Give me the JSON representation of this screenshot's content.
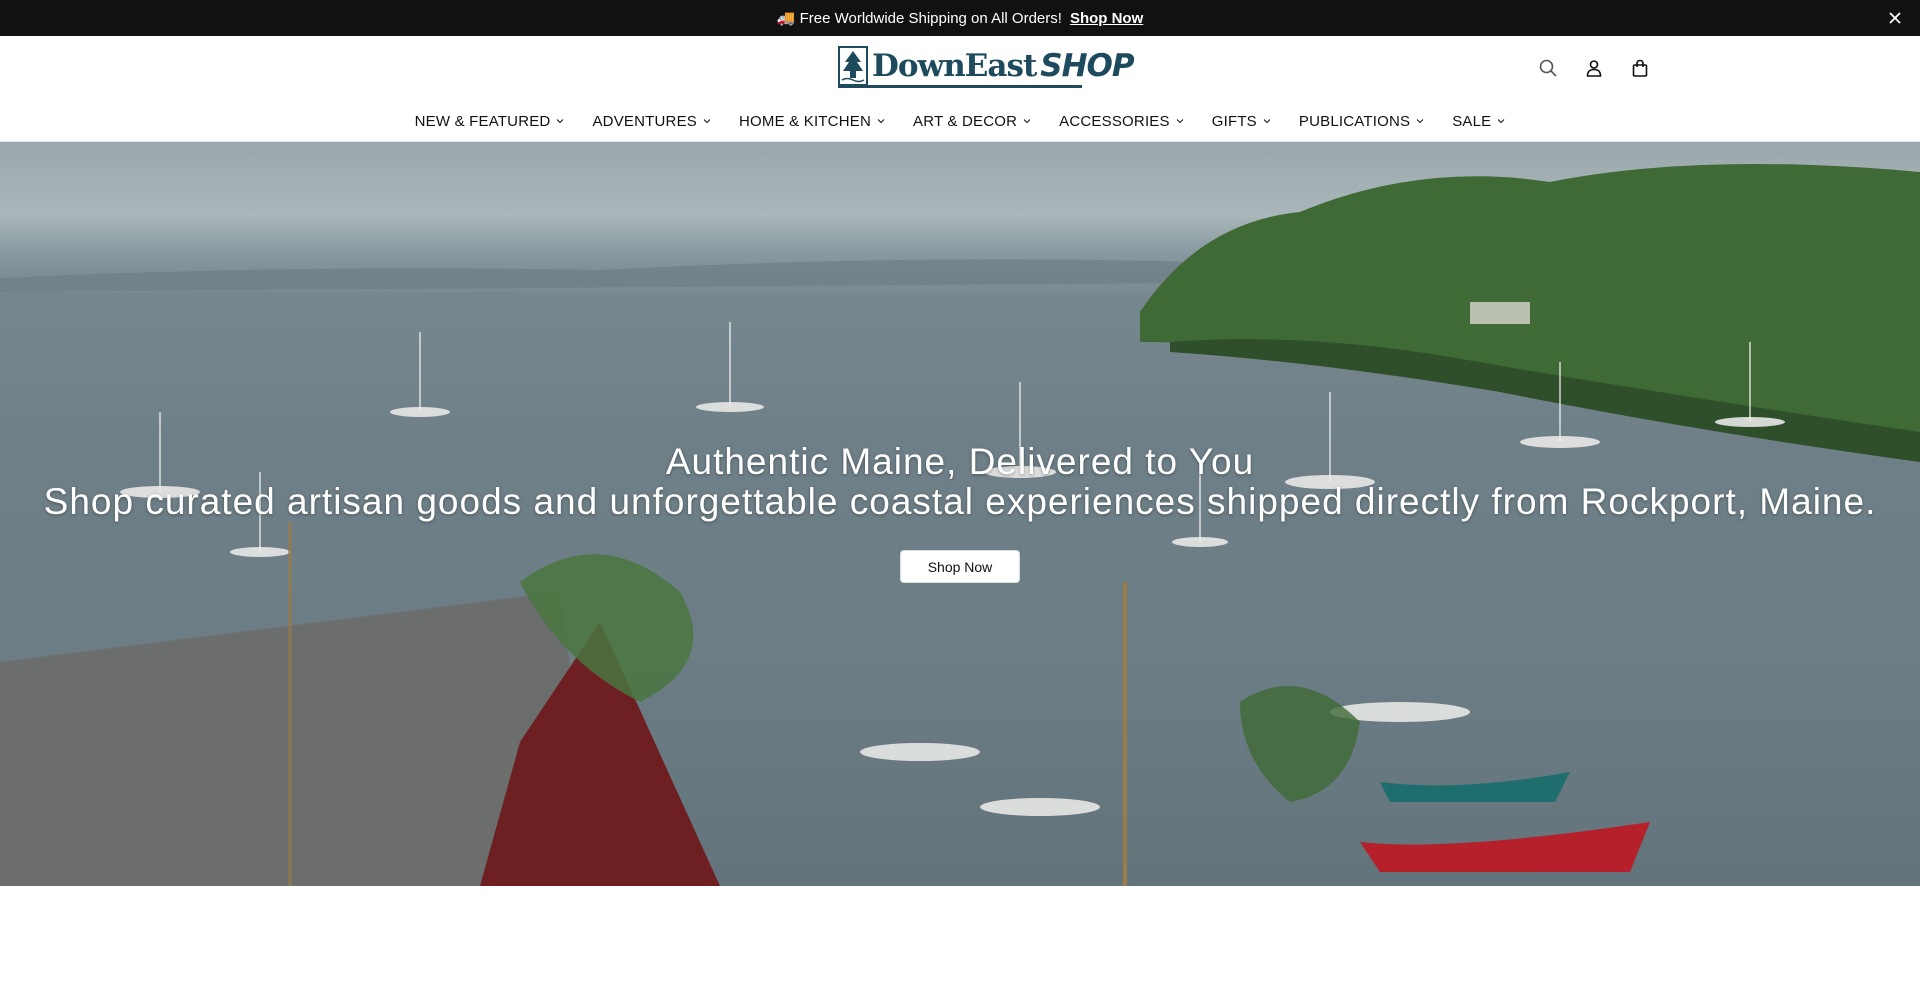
{
  "announcement": {
    "message": "🚚 Free Worldwide Shipping on All Orders!",
    "link_label": "Shop Now",
    "close_icon": "close-icon"
  },
  "header": {
    "logo_text": "DownEast",
    "logo_text_2": "SHOP",
    "icons": [
      "search-icon",
      "account-icon",
      "cart-icon"
    ]
  },
  "nav": {
    "items": [
      {
        "label": "NEW & FEATURED"
      },
      {
        "label": "ADVENTURES"
      },
      {
        "label": "HOME & KITCHEN"
      },
      {
        "label": "ART & DECOR"
      },
      {
        "label": "ACCESSORIES"
      },
      {
        "label": "GIFTS"
      },
      {
        "label": "PUBLICATIONS"
      },
      {
        "label": "SALE"
      }
    ]
  },
  "hero": {
    "title": "Authentic Maine, Delivered to You",
    "subtitle": "Shop curated artisan goods and unforgettable coastal experiences shipped directly from Rockport, Maine.",
    "button_label": "Shop Now"
  },
  "colors": {
    "announcement_bg": "#111111",
    "brand": "#1e4a5e",
    "button_bg": "#ffffff"
  }
}
